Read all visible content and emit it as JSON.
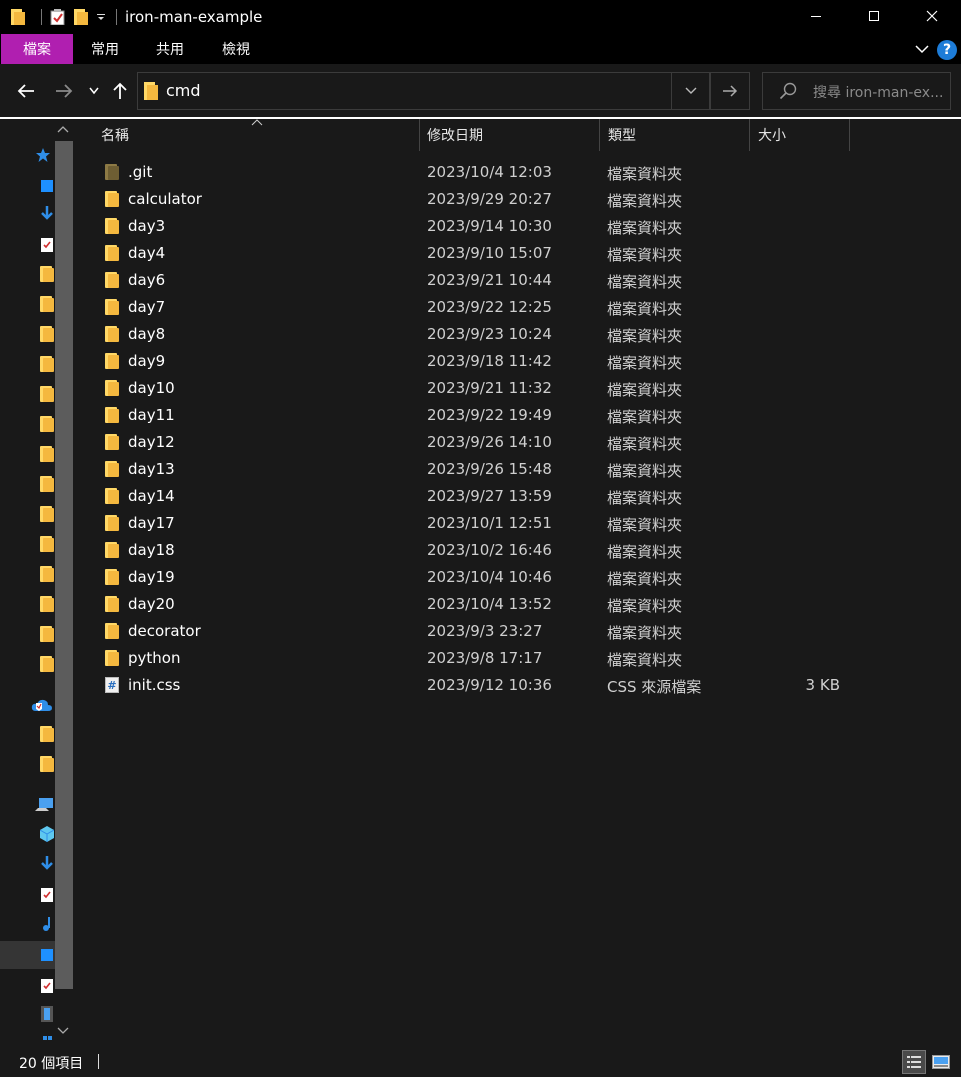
{
  "window": {
    "title": "iron-man-example",
    "minimize_icon": "minimize-icon",
    "maximize_icon": "maximize-icon",
    "close_icon": "close-icon"
  },
  "ribbon": {
    "tabs": [
      {
        "label": "檔案"
      },
      {
        "label": "常用"
      },
      {
        "label": "共用"
      },
      {
        "label": "檢視"
      }
    ],
    "accent_color": "#b01fb0",
    "help_label": "?"
  },
  "address": {
    "path": "cmd"
  },
  "search": {
    "placeholder": "搜尋 iron-man-ex..."
  },
  "columns": {
    "name": "名稱",
    "date": "修改日期",
    "type": "類型",
    "size": "大小"
  },
  "files": [
    {
      "name": ".git",
      "date": "2023/10/4 12:03",
      "type": "檔案資料夾",
      "size": "",
      "icon": "folder-icon"
    },
    {
      "name": "calculator",
      "date": "2023/9/29 20:27",
      "type": "檔案資料夾",
      "size": "",
      "icon": "folder-icon"
    },
    {
      "name": "day3",
      "date": "2023/9/14 10:30",
      "type": "檔案資料夾",
      "size": "",
      "icon": "folder-icon"
    },
    {
      "name": "day4",
      "date": "2023/9/10 15:07",
      "type": "檔案資料夾",
      "size": "",
      "icon": "folder-icon"
    },
    {
      "name": "day6",
      "date": "2023/9/21 10:44",
      "type": "檔案資料夾",
      "size": "",
      "icon": "folder-icon"
    },
    {
      "name": "day7",
      "date": "2023/9/22 12:25",
      "type": "檔案資料夾",
      "size": "",
      "icon": "folder-icon"
    },
    {
      "name": "day8",
      "date": "2023/9/23 10:24",
      "type": "檔案資料夾",
      "size": "",
      "icon": "folder-icon"
    },
    {
      "name": "day9",
      "date": "2023/9/18 11:42",
      "type": "檔案資料夾",
      "size": "",
      "icon": "folder-icon"
    },
    {
      "name": "day10",
      "date": "2023/9/21 11:32",
      "type": "檔案資料夾",
      "size": "",
      "icon": "folder-icon"
    },
    {
      "name": "day11",
      "date": "2023/9/22 19:49",
      "type": "檔案資料夾",
      "size": "",
      "icon": "folder-icon"
    },
    {
      "name": "day12",
      "date": "2023/9/26 14:10",
      "type": "檔案資料夾",
      "size": "",
      "icon": "folder-icon"
    },
    {
      "name": "day13",
      "date": "2023/9/26 15:48",
      "type": "檔案資料夾",
      "size": "",
      "icon": "folder-icon"
    },
    {
      "name": "day14",
      "date": "2023/9/27 13:59",
      "type": "檔案資料夾",
      "size": "",
      "icon": "folder-icon"
    },
    {
      "name": "day17",
      "date": "2023/10/1 12:51",
      "type": "檔案資料夾",
      "size": "",
      "icon": "folder-icon"
    },
    {
      "name": "day18",
      "date": "2023/10/2 16:46",
      "type": "檔案資料夾",
      "size": "",
      "icon": "folder-icon"
    },
    {
      "name": "day19",
      "date": "2023/10/4 10:46",
      "type": "檔案資料夾",
      "size": "",
      "icon": "folder-icon"
    },
    {
      "name": "day20",
      "date": "2023/10/4 13:52",
      "type": "檔案資料夾",
      "size": "",
      "icon": "folder-icon"
    },
    {
      "name": "decorator",
      "date": "2023/9/3 23:27",
      "type": "檔案資料夾",
      "size": "",
      "icon": "folder-icon"
    },
    {
      "name": "python",
      "date": "2023/9/8 17:17",
      "type": "檔案資料夾",
      "size": "",
      "icon": "folder-icon"
    },
    {
      "name": "init.css",
      "date": "2023/9/12 10:36",
      "type": "CSS 來源檔案",
      "size": "3 KB",
      "icon": "css-file-icon"
    }
  ],
  "status": {
    "item_count": "20 個項目"
  },
  "colors": {
    "folder": "#f4b83f",
    "background": "#191919",
    "help": "#1d7cd8",
    "quick_access_star": "#2f8ee8"
  }
}
